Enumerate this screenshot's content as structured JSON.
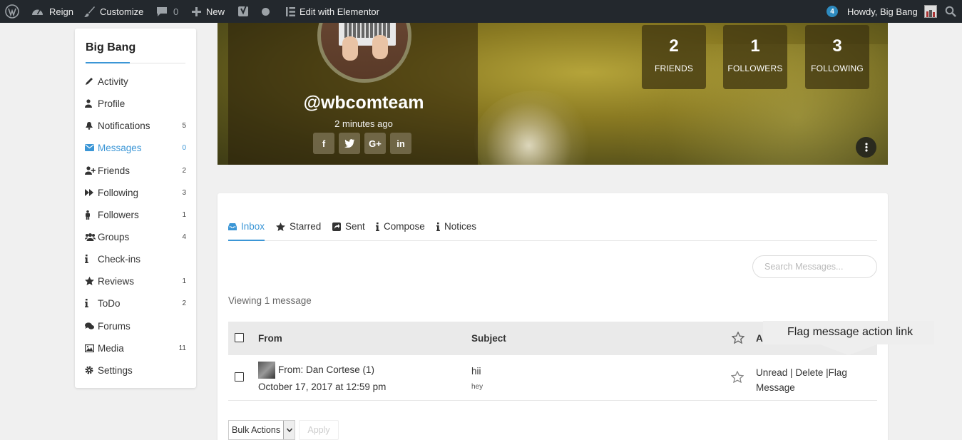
{
  "adminbar": {
    "site_name": "Reign",
    "customize": "Customize",
    "comments_count": "0",
    "new_label": "New",
    "elementor": "Edit with Elementor",
    "notifications_count": "4",
    "howdy": "Howdy, Big Bang"
  },
  "sidebar": {
    "title": "Big Bang",
    "items": [
      {
        "label": "Activity",
        "count": "",
        "icon": "pencil-icon"
      },
      {
        "label": "Profile",
        "count": "",
        "icon": "user-icon"
      },
      {
        "label": "Notifications",
        "count": "5",
        "icon": "bell-icon"
      },
      {
        "label": "Messages",
        "count": "0",
        "icon": "envelope-icon"
      },
      {
        "label": "Friends",
        "count": "2",
        "icon": "user-plus-icon"
      },
      {
        "label": "Following",
        "count": "3",
        "icon": "fast-forward-icon"
      },
      {
        "label": "Followers",
        "count": "1",
        "icon": "person-icon"
      },
      {
        "label": "Groups",
        "count": "4",
        "icon": "users-icon"
      },
      {
        "label": "Check-ins",
        "count": "",
        "icon": "info-icon"
      },
      {
        "label": "Reviews",
        "count": "1",
        "icon": "star-icon"
      },
      {
        "label": "ToDo",
        "count": "2",
        "icon": "info-icon"
      },
      {
        "label": "Forums",
        "count": "",
        "icon": "comments-icon"
      },
      {
        "label": "Media",
        "count": "11",
        "icon": "image-icon"
      },
      {
        "label": "Settings",
        "count": "",
        "icon": "gear-icon"
      }
    ]
  },
  "cover": {
    "username": "@wbcomteam",
    "last_active": "2 minutes ago",
    "social": [
      "f",
      "t",
      "G+",
      "in"
    ],
    "stats": [
      {
        "num": "2",
        "label": "FRIENDS"
      },
      {
        "num": "1",
        "label": "FOLLOWERS"
      },
      {
        "num": "3",
        "label": "FOLLOWING"
      }
    ]
  },
  "messages": {
    "tabs": [
      {
        "label": "Inbox"
      },
      {
        "label": "Starred"
      },
      {
        "label": "Sent"
      },
      {
        "label": "Compose"
      },
      {
        "label": "Notices"
      }
    ],
    "search_placeholder": "Search Messages...",
    "viewing": "Viewing 1 message",
    "headers": {
      "from": "From",
      "subject": "Subject",
      "actions": "Actions"
    },
    "rows": [
      {
        "from": "From: Dan Cortese (1)",
        "date": "October 17, 2017 at 12:59 pm",
        "subject": "hii",
        "excerpt": "hey",
        "unread": "Unread",
        "sep1": "|",
        "delete": "Delete",
        "sep2": "|",
        "flag": "Flag",
        "flag2": "Message"
      }
    ],
    "bulk_actions": "Bulk Actions",
    "apply": "Apply"
  },
  "tooltip": "Flag message action link",
  "colors": {
    "accent": "#3b96d6",
    "adminbar": "#23282d"
  }
}
